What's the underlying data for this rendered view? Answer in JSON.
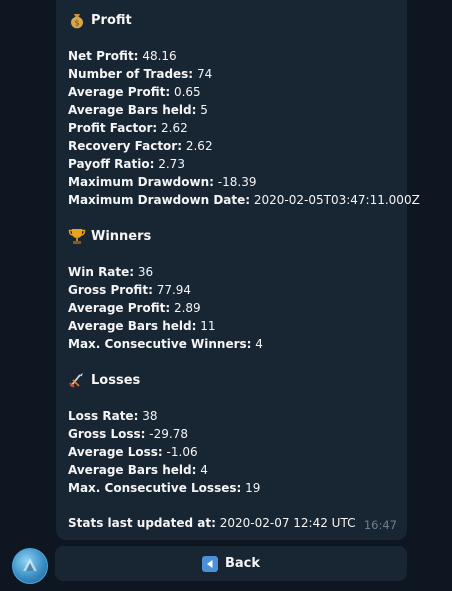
{
  "message": {
    "time": "16:47",
    "profit": {
      "icon": "money-bag-icon",
      "title": "Profit",
      "rows": [
        {
          "label": "Net Profit:",
          "value": "48.16"
        },
        {
          "label": "Number of Trades:",
          "value": "74"
        },
        {
          "label": "Average Profit:",
          "value": "0.65"
        },
        {
          "label": "Average Bars held:",
          "value": "5"
        },
        {
          "label": "Profit Factor:",
          "value": "2.62"
        },
        {
          "label": "Recovery Factor:",
          "value": "2.62"
        },
        {
          "label": "Payoff Ratio:",
          "value": "2.73"
        },
        {
          "label": "Maximum Drawdown:",
          "value": "-18.39"
        },
        {
          "label": "Maximum Drawdown Date:",
          "value": "2020-02-05T03:47:11.000Z"
        }
      ]
    },
    "winners": {
      "icon": "trophy-icon",
      "title": "Winners",
      "rows": [
        {
          "label": "Win Rate:",
          "value": "36"
        },
        {
          "label": "Gross Profit:",
          "value": "77.94"
        },
        {
          "label": "Average Profit:",
          "value": "2.89"
        },
        {
          "label": "Average Bars held:",
          "value": "11"
        },
        {
          "label": "Max. Consecutive Winners:",
          "value": "4"
        }
      ]
    },
    "losses": {
      "icon": "crossed-swords-icon",
      "title": "Losses",
      "rows": [
        {
          "label": "Loss Rate:",
          "value": "38"
        },
        {
          "label": "Gross Loss:",
          "value": "-29.78"
        },
        {
          "label": "Average Loss:",
          "value": "-1.06"
        },
        {
          "label": "Average Bars held:",
          "value": "4"
        },
        {
          "label": "Max. Consecutive Losses:",
          "value": "19"
        }
      ]
    },
    "footer": {
      "label": "Stats last updated at:",
      "value": "2020-02-07 12:42 UTC"
    }
  },
  "keyboard": {
    "back_label": "Back",
    "back_icon": "left-arrow-icon"
  },
  "colors": {
    "background": "#0e1621",
    "bubble": "#182533",
    "accent": "#4b90d8"
  }
}
